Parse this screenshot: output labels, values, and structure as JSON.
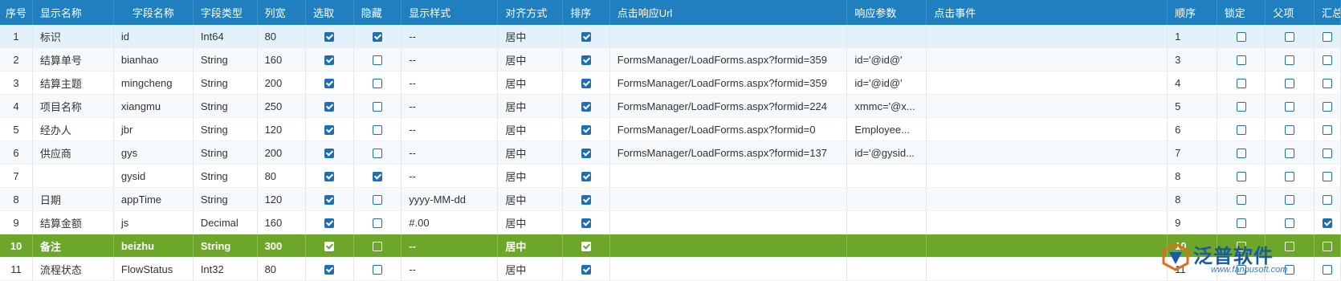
{
  "grid": {
    "headers": [
      "序号",
      "显示名称",
      "字段名称",
      "字段类型",
      "列宽",
      "选取",
      "隐藏",
      "显示样式",
      "对齐方式",
      "排序",
      "点击响应Url",
      "响应参数",
      "点击事件",
      "顺序",
      "锁定",
      "父项",
      "汇总"
    ],
    "rows": [
      {
        "no": "1",
        "display": "标识",
        "field": "id",
        "type": "Int64",
        "width": "80",
        "select": true,
        "hide": true,
        "style": "--",
        "align": "居中",
        "sort": true,
        "url": "",
        "param": "",
        "event": "",
        "order": "1",
        "lock": false,
        "parent": false,
        "sum": false
      },
      {
        "no": "2",
        "display": "结算单号",
        "field": "bianhao",
        "type": "String",
        "width": "160",
        "select": true,
        "hide": false,
        "style": "--",
        "align": "居中",
        "sort": true,
        "url": "FormsManager/LoadForms.aspx?formid=359",
        "param": "id='@id@'",
        "event": "",
        "order": "3",
        "lock": false,
        "parent": false,
        "sum": false
      },
      {
        "no": "3",
        "display": "结算主题",
        "field": "mingcheng",
        "type": "String",
        "width": "200",
        "select": true,
        "hide": false,
        "style": "--",
        "align": "居中",
        "sort": true,
        "url": "FormsManager/LoadForms.aspx?formid=359",
        "param": "id='@id@'",
        "event": "",
        "order": "4",
        "lock": false,
        "parent": false,
        "sum": false
      },
      {
        "no": "4",
        "display": "项目名称",
        "field": "xiangmu",
        "type": "String",
        "width": "250",
        "select": true,
        "hide": false,
        "style": "--",
        "align": "居中",
        "sort": true,
        "url": "FormsManager/LoadForms.aspx?formid=224",
        "param": "xmmc='@x...",
        "event": "",
        "order": "5",
        "lock": false,
        "parent": false,
        "sum": false
      },
      {
        "no": "5",
        "display": "经办人",
        "field": "jbr",
        "type": "String",
        "width": "120",
        "select": true,
        "hide": false,
        "style": "--",
        "align": "居中",
        "sort": true,
        "url": "FormsManager/LoadForms.aspx?formid=0",
        "param": "Employee...",
        "event": "",
        "order": "6",
        "lock": false,
        "parent": false,
        "sum": false
      },
      {
        "no": "6",
        "display": "供应商",
        "field": "gys",
        "type": "String",
        "width": "200",
        "select": true,
        "hide": false,
        "style": "--",
        "align": "居中",
        "sort": true,
        "url": "FormsManager/LoadForms.aspx?formid=137",
        "param": "id='@gysid...",
        "event": "",
        "order": "7",
        "lock": false,
        "parent": false,
        "sum": false
      },
      {
        "no": "7",
        "display": "",
        "field": "gysid",
        "type": "String",
        "width": "80",
        "select": true,
        "hide": true,
        "style": "--",
        "align": "居中",
        "sort": true,
        "url": "",
        "param": "",
        "event": "",
        "order": "8",
        "lock": false,
        "parent": false,
        "sum": false
      },
      {
        "no": "8",
        "display": "日期",
        "field": "appTime",
        "type": "String",
        "width": "120",
        "select": true,
        "hide": false,
        "style": "yyyy-MM-dd",
        "align": "居中",
        "sort": true,
        "url": "",
        "param": "",
        "event": "",
        "order": "8",
        "lock": false,
        "parent": false,
        "sum": false
      },
      {
        "no": "9",
        "display": "结算金额",
        "field": "js",
        "type": "Decimal",
        "width": "160",
        "select": true,
        "hide": false,
        "style": "#.00",
        "align": "居中",
        "sort": true,
        "url": "",
        "param": "",
        "event": "",
        "order": "9",
        "lock": false,
        "parent": false,
        "sum": true
      },
      {
        "no": "10",
        "display": "备注",
        "field": "beizhu",
        "type": "String",
        "width": "300",
        "select": true,
        "hide": false,
        "style": "--",
        "align": "居中",
        "sort": true,
        "url": "",
        "param": "",
        "event": "",
        "order": "10",
        "lock": false,
        "parent": false,
        "sum": false
      },
      {
        "no": "11",
        "display": "流程状态",
        "field": "FlowStatus",
        "type": "Int32",
        "width": "80",
        "select": true,
        "hide": false,
        "style": "--",
        "align": "居中",
        "sort": true,
        "url": "",
        "param": "",
        "event": "",
        "order": "11",
        "lock": false,
        "parent": false,
        "sum": false
      }
    ],
    "selected_row": 9
  },
  "watermark": {
    "brand": "泛普软件",
    "url": "www.fanpusoft.com"
  },
  "colors": {
    "header_bg": "#1f7fbf",
    "selected_row": "#6ca72a",
    "checkbox": "#1f6fb0"
  }
}
